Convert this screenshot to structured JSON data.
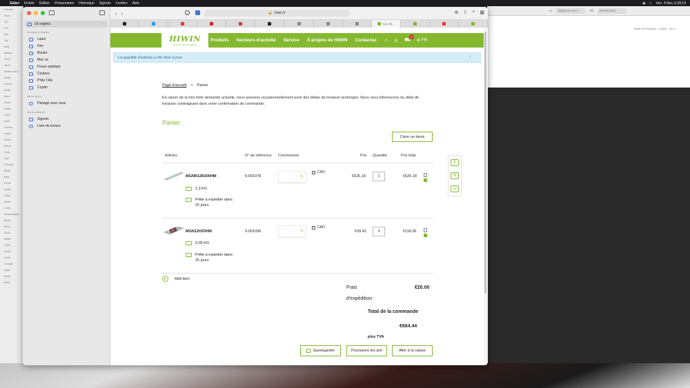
{
  "menubar": {
    "app": "Safari",
    "items": [
      "Fichier",
      "Édition",
      "Présentation",
      "Historique",
      "Signets",
      "Fenêtre",
      "Aide"
    ],
    "clock": "Ven. 4 Nov. à 09:19"
  },
  "bg_right": {
    "search_placeholder": "Déplacer vers...",
    "search2_placeholder": "Rechercher",
    "icloud": "Boîte de réception - iCloud",
    "time": "09:17"
  },
  "bg_left_rows": [
    "Favoris",
    "Touri",
    "Cli",
    "Pro",
    "Bro",
    "Sol",
    "Eng",
    "Messa",
    "Touri",
    "Touri",
    "Boîtes aux l",
    "Assis",
    "iCloud",
    "Boîte",
    "Brou",
    "Envo",
    "Indés",
    "Corb",
    "Arch",
    "Comm",
    "Courr",
    "Eleve",
    "Eleve",
    "Sent",
    "Topl",
    "Pr?relle",
    "Boîte",
    "Brou",
    "Envo",
    "Indés",
    "Corb",
    "Archi",
    "Junk",
    "amazon@pl",
    "Boîte",
    "Brou",
    "Envo",
    "Indés",
    "Corb",
    "Archi",
    "Junk",
    "Google",
    "Impo",
    "Boîte",
    "Brou"
  ],
  "sidebar": {
    "group_title": "16 onglets",
    "groups_header": "Groupes d'onglets",
    "groups": [
      "Laine",
      "Dev",
      "Boulot",
      "Mac os",
      "Fosse septique",
      "Couture",
      "P'tite Tête",
      "Crypto"
    ],
    "shared_header": "Liens reçus",
    "shared": [
      "Partagé avec vous"
    ],
    "library_header": "Liens collectés",
    "library": [
      "Signets",
      "Liste de lecture"
    ]
  },
  "toolbar": {
    "url": "hiwin.fr",
    "active_tab": "Your Sh..."
  },
  "header": {
    "logo": "HIWIN",
    "logo_sub": "Motion Control & Systems",
    "nav": [
      "Produits",
      "Secteurs d'activité",
      "Service",
      "À propos de HIWIN",
      "Contactez"
    ],
    "cart_count": "2",
    "lang": "FR"
  },
  "alert": "La quantité d'articles a été mise à jour.",
  "breadcrumb": {
    "home": "Page d'accueil",
    "sep": "»",
    "current": "Panier"
  },
  "notice": "En raison de la très forte demande actuelle, nous pouvons occasionnellement avoir des délais de livraison prolongés. Nous vous informerons du délai de livraison contraignant dans notre confirmation de commande.",
  "title": "Panier",
  "quote_button": "Créer un devis",
  "columns": {
    "articles": "Articles",
    "ref": "N° de référence",
    "commission": "Commission",
    "price": "Prix",
    "qty": "Quantité",
    "total": "Prix total"
  },
  "items": [
    {
      "sku": "MGNR12R200HM",
      "ref": "5-001078",
      "cao": "CAO",
      "price": "€526.18",
      "qty": "1",
      "total": "€526.18",
      "weight": "1,3 KG",
      "ship": "Prête à expédier dans",
      "ship2": "25 jours"
    },
    {
      "sku": "MGN12HZ0HM",
      "ref": "5-001036",
      "cao": "CAO",
      "price": "€39.42",
      "qty": "3",
      "total": "€118.26",
      "weight": "0,05 KG",
      "ship": "Prête à expédier dans",
      "ship2": "25 jours"
    }
  ],
  "add_item": "Add item",
  "summary": {
    "shipping_label": "Frais",
    "shipping_label2": "d'expédition :",
    "shipping_value": "€20.00",
    "total_label": "Total de la commande",
    "total_value": "€664.44",
    "vat": "plus TVA"
  },
  "actions": {
    "save": "Sauvegarder",
    "continue": "Poursuivre les ach",
    "checkout": "Aller à la caisse"
  },
  "colors": {
    "accent": "#84b92f",
    "alert_bg": "#d5edf7",
    "badge": "#d0303a"
  }
}
